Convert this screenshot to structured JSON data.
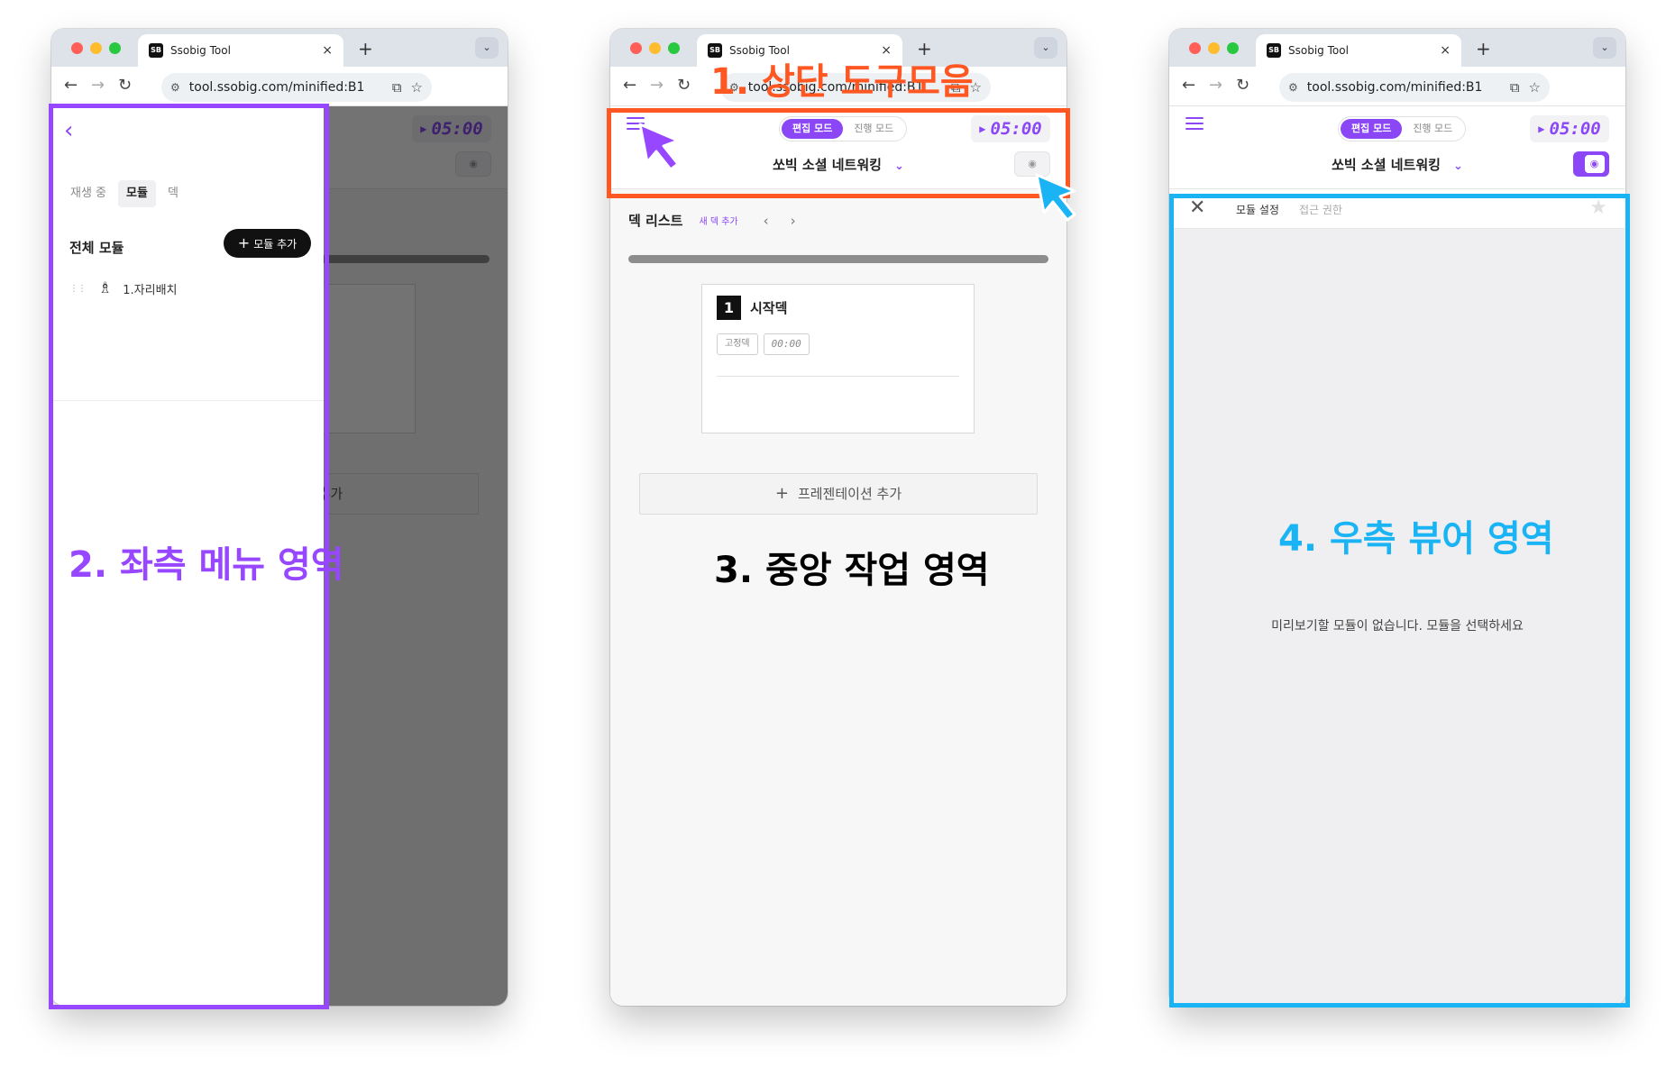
{
  "browser": {
    "tab_title": "Ssobig Tool",
    "favicon_text": "SB",
    "url": "tool.ssobig.com/minified:B1",
    "new_tab": "+",
    "tab_close": "×",
    "tab_menu": "⌄"
  },
  "app": {
    "mode_edit": "편집 모드",
    "mode_run": "진행 모드",
    "timer": "05:00",
    "title": "쏘빅 소셜 네트워킹",
    "preview_icon": "eye-icon"
  },
  "center": {
    "deck_list_title": "덱 리스트",
    "new_deck_link": "새 덱 추가",
    "card_number": "1",
    "card_title": "시작덱",
    "chip_fixed": "고정덱",
    "chip_time": "00:00",
    "add_presentation": "프레젠테이션 추가",
    "progress_fraction": 1.0
  },
  "left_menu": {
    "tabs": [
      "재생 중",
      "모듈",
      "덱"
    ],
    "active_tab": "모듈",
    "section_title": "전체 모듈",
    "add_button": "모듈 추가",
    "items": [
      {
        "label": "1.자리배치",
        "icon": "seating-icon"
      }
    ]
  },
  "viewer": {
    "tabs": [
      "모듈 설정",
      "접근 권한"
    ],
    "active_tab": "모듈 설정",
    "empty_message": "미리보기할 모듈이 없습니다. 모듈을 선택하세요"
  },
  "annotations": {
    "top_toolbar": "1. 상단 도구모음",
    "left_menu": "2. 좌측 메뉴 영역",
    "center_work": "3. 중앙 작업 영역",
    "right_viewer": "4. 우측 뷰어 영역"
  },
  "colors": {
    "accent": "#8b47f5",
    "toolbar_highlight": "#ff5722",
    "left_highlight": "#9747ff",
    "right_highlight": "#1ab4f5"
  }
}
